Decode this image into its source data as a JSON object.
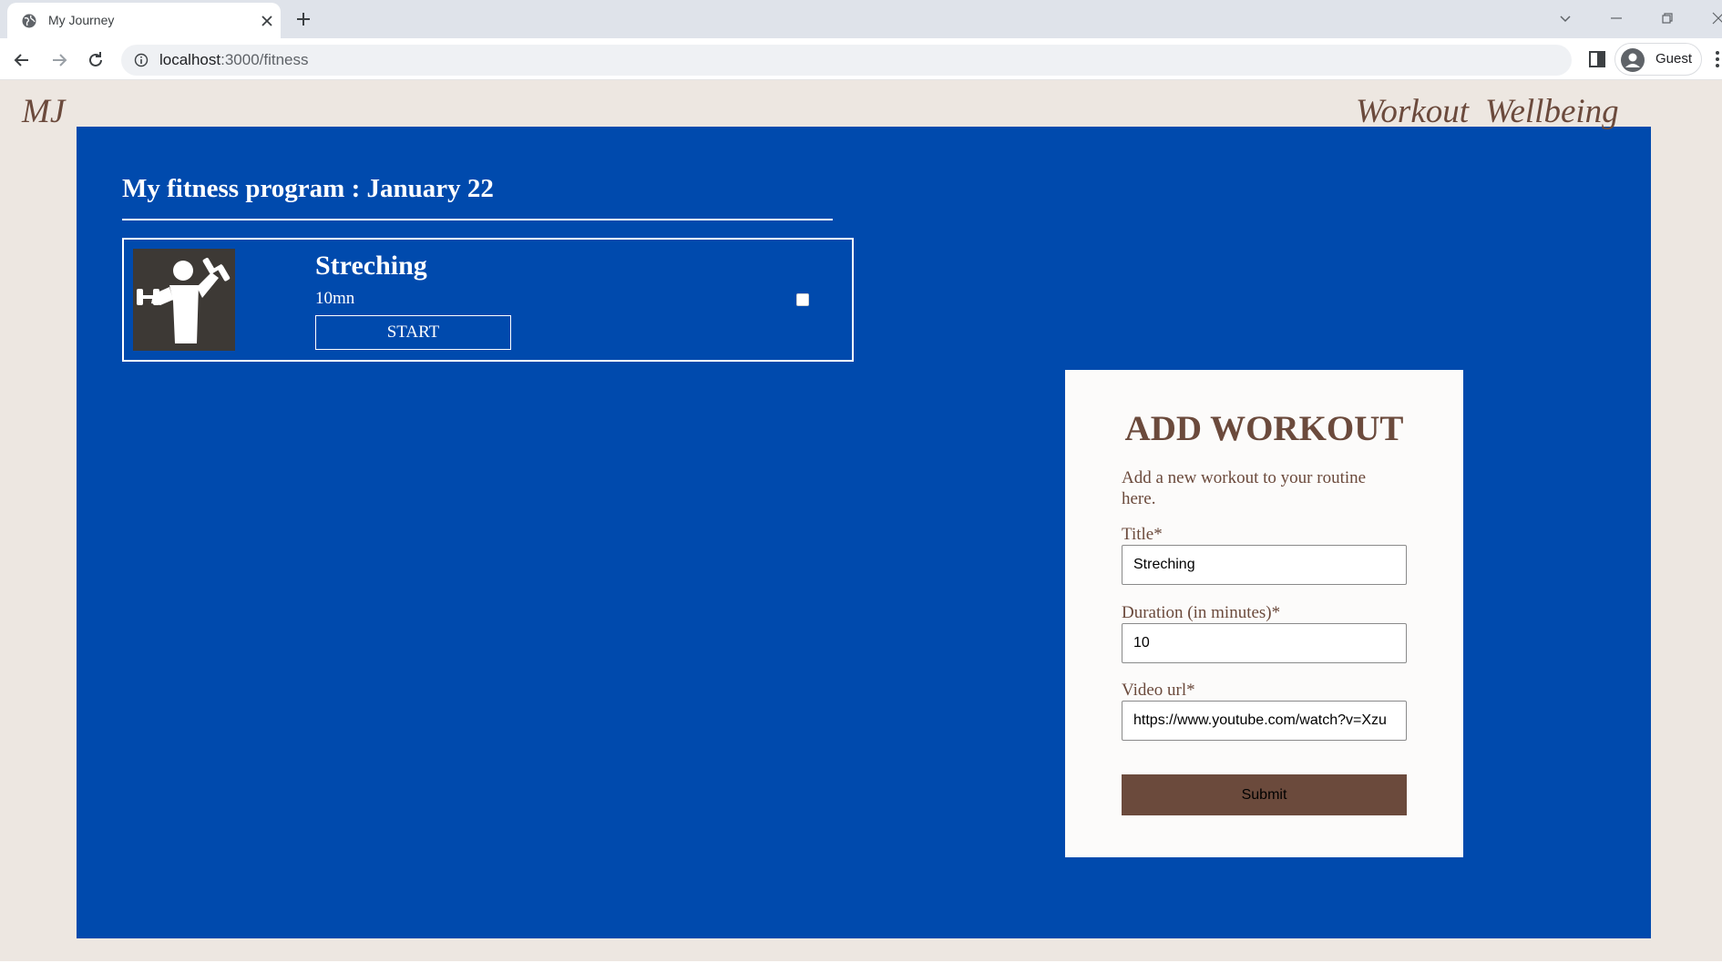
{
  "browser": {
    "tab_title": "My Journey",
    "url_host": "localhost",
    "url_path": ":3000/fitness",
    "profile_name": "Guest"
  },
  "nav": {
    "brand": "MJ",
    "links": [
      "Workout",
      "Wellbeing"
    ]
  },
  "program": {
    "title": "My fitness program : January 22",
    "workouts": [
      {
        "name": "Streching",
        "duration": "10mn",
        "start_label": "START",
        "image_icon": "dumbbell-person-icon",
        "completed": false
      }
    ]
  },
  "form": {
    "heading": "ADD WORKOUT",
    "description": "Add a new workout to your routine here.",
    "title_label": "Title*",
    "title_value": "Streching",
    "duration_label": "Duration (in minutes)*",
    "duration_value": "10",
    "video_label": "Video url*",
    "video_value": "https://www.youtube.com/watch?v=Xzu",
    "submit_label": "Submit"
  },
  "colors": {
    "page_background": "#ede7e1",
    "panel_blue": "#004aad",
    "brand_brown": "#6b4a3c",
    "card_background": "#fcfbfa",
    "image_background": "#3d3935"
  }
}
